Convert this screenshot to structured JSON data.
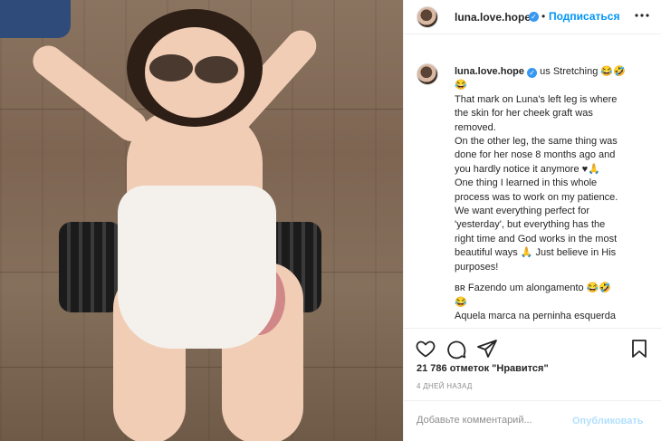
{
  "post": {
    "username": "luna.love.hope",
    "verified_mark": "✓",
    "dot": "•",
    "follow_label": "Подписаться",
    "more_icon": "more-horizontal-icon"
  },
  "caption": {
    "username": "luna.love.hope",
    "lines": [
      "us Stretching 😂🤣",
      "😂",
      "That mark on Luna's left leg is where",
      "the skin for her cheek graft was",
      "removed.",
      "On the other leg, the same thing was",
      "done for her nose 8 months ago and",
      "you hardly notice it anymore ♥🙏",
      "One thing I learned in this whole",
      "process was to work on my patience.",
      "We want everything perfect for",
      "'yesterday', but everything has the",
      "right time and God works in the most",
      "beautiful ways 🙏 Just believe in His",
      "purposes!",
      "",
      "ʙʀ Fazendo um alongamento 😂🤣",
      "😂",
      "Aquela marca na perninha esquerda"
    ]
  },
  "actions": {
    "like_icon": "heart-icon",
    "comment_icon": "comment-icon",
    "share_icon": "send-icon",
    "save_icon": "bookmark-icon"
  },
  "likes_text": "21 786 отметок \"Нравится\"",
  "time_text": "4 ДНЕЙ НАЗАД",
  "comment_box": {
    "placeholder": "Добавьте комментарий...",
    "publish_label": "Опубликовать"
  },
  "colors": {
    "link": "#0095f6",
    "verified": "#3897f0",
    "publish_disabled": "#b2dffc",
    "muted": "#8e8e8e"
  }
}
